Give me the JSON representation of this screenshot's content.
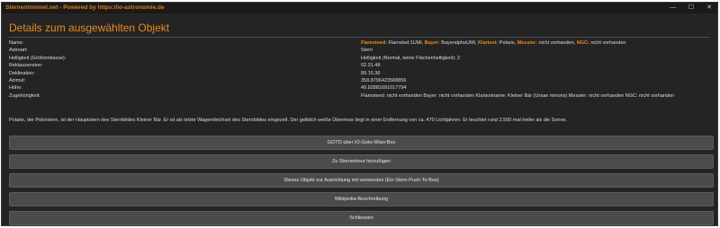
{
  "window": {
    "title": "Sternenhimmel.net - Powered by https://io-astronomie.de",
    "controls": {
      "minimize": "—",
      "maximize": "☐",
      "close": "✕"
    }
  },
  "heading": "Details zum ausgewählten Objekt",
  "properties": [
    {
      "label": "Name:",
      "value": ""
    },
    {
      "label": "Astroart:",
      "value": "Stern"
    },
    {
      "label": "Helligkeit (Größenklasse):",
      "value": "Helligkeit (Normal, keine Flächenhelligkeit): 2"
    },
    {
      "label": "Rektaszension:",
      "value": "02.31.48"
    },
    {
      "label": "Deklination:",
      "value": "89.15.36"
    },
    {
      "label": "Azimut:",
      "value": "358.8796423588856"
    },
    {
      "label": "Höhe:",
      "value": "49.92881691017794"
    },
    {
      "label": "Zugehörigkeit:",
      "value": "Flamsteed: nicht vorhanden  Bayer: nicht vorhanden  Klartextname: Kleiner Bär (Ursae minoris) Messier: nicht vorhanden NGC: nicht vorhanden"
    }
  ],
  "name_value": {
    "flamsteed_label": "Flamsteed:",
    "flamsteed_value": "Flamsted:1UMi,",
    "bayer_label": "Bayer:",
    "bayer_value": "BayeralphaUMi,",
    "klartext_label": "Klartext:",
    "klartext_value": "Polaris,",
    "messier_label": "Messier:",
    "messier_value": "nicht vorhanden,",
    "ngc_label": "NGC:",
    "ngc_value": "nicht vorhanden"
  },
  "description": "Polaris, der Polorstern, ist der Hauptstern des Sternbildes Kleiner Bär. Er ist als letzte Wagendeichsel des Sternbildes eingezeit. Der gelblich weiße Überriese liegt in einer Entfernung von ca. 470 Lichtjahren. Er leuchtet rund 2.500 mal heller als die Sonne.",
  "buttons": {
    "goto": "GOTO über IO-Goto-Wlan-Box",
    "tour": "Zu Sternentour hinzufügen",
    "align": "Dieses Objekt zur Ausrichtung mit verwenden (Ein Stern-Push-To-Box)",
    "wiki": "Wikipedia-Beschreibung",
    "close": "Schliessen"
  },
  "colors": {
    "accent": "#e98a1f",
    "background": "#242424",
    "button": "#4b4b4b",
    "text": "#dcdcdc"
  }
}
